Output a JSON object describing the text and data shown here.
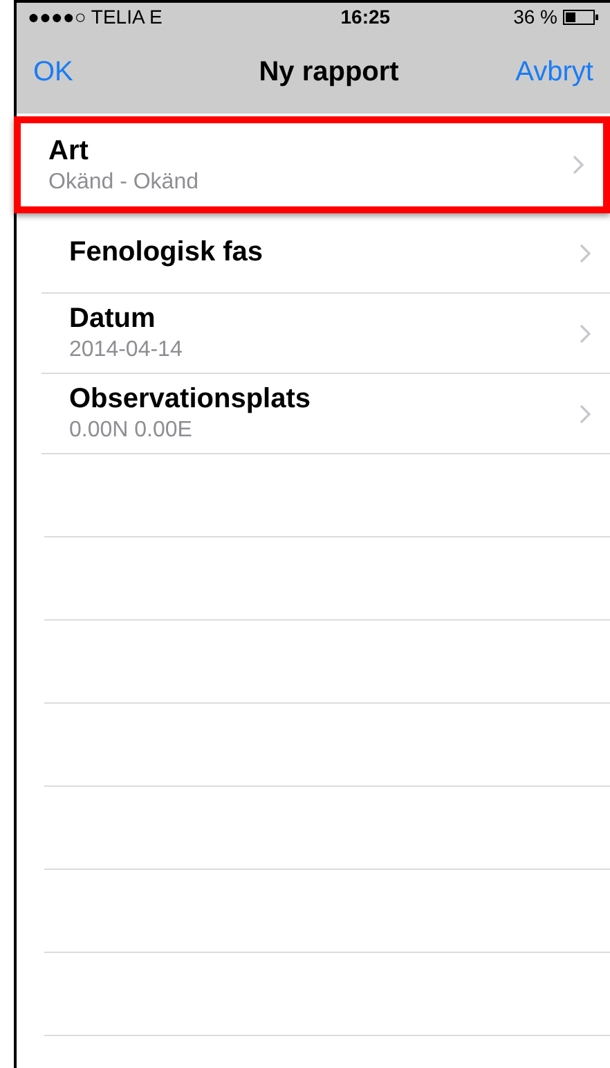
{
  "status_bar": {
    "carrier": "●●●●○ TELIA  E",
    "time": "16:25",
    "battery": "36 %"
  },
  "nav_bar": {
    "left_button": "OK",
    "title": "Ny rapport",
    "right_button": "Avbryt"
  },
  "rows": [
    {
      "title": "Art",
      "subtitle": "Okänd - Okänd",
      "highlighted": true
    },
    {
      "title": "Fenologisk fas",
      "highlighted": false
    },
    {
      "title": "Datum",
      "subtitle": "2014-04-14",
      "highlighted": false
    },
    {
      "title": "Observationsplats",
      "subtitle": "0.00N 0.00E",
      "highlighted": false
    }
  ]
}
